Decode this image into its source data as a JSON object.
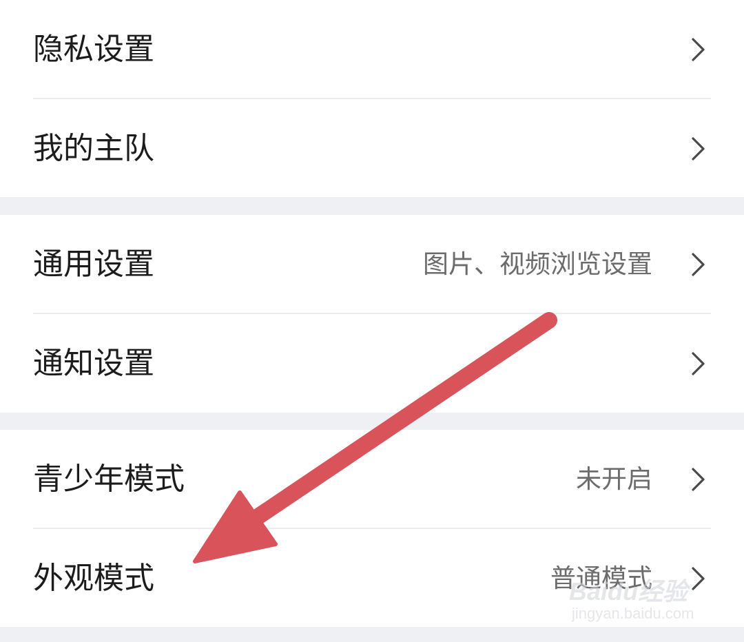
{
  "sections": [
    {
      "items": [
        {
          "label": "隐私设置",
          "value": ""
        },
        {
          "label": "我的主队",
          "value": ""
        }
      ]
    },
    {
      "items": [
        {
          "label": "通用设置",
          "value": "图片、视频浏览设置"
        },
        {
          "label": "通知设置",
          "value": ""
        }
      ]
    },
    {
      "items": [
        {
          "label": "青少年模式",
          "value": "未开启"
        },
        {
          "label": "外观模式",
          "value": "普通模式"
        }
      ]
    }
  ],
  "icons": {
    "row_chevron": "chevron-right-icon"
  },
  "annotation": {
    "arrow_color": "#d9535b",
    "arrow_target": "外观模式"
  },
  "watermark": {
    "brand": "Baidu经验",
    "url": "jingyan.baidu.com"
  },
  "colors": {
    "background": "#eef0f4",
    "row_background": "#ffffff",
    "label_text": "#1c1c1c",
    "value_text": "#6c6c6c",
    "chevron": "#4a4a4a"
  }
}
